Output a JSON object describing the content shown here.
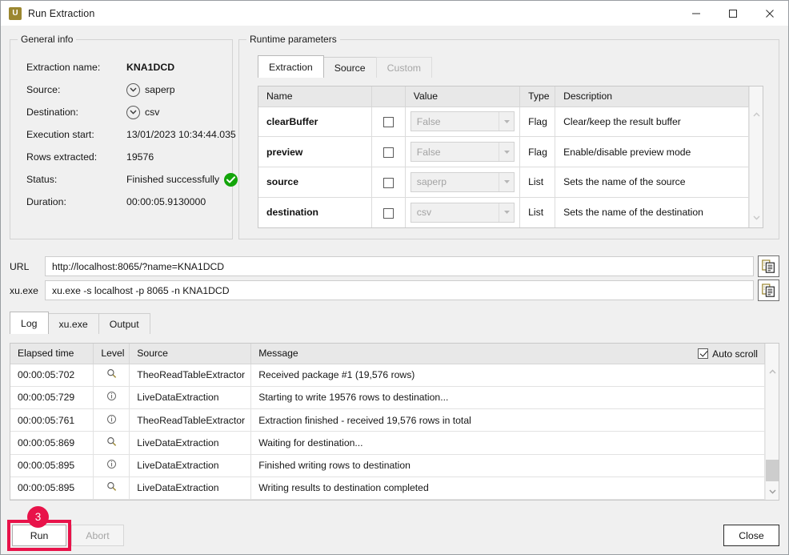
{
  "window": {
    "title": "Run Extraction",
    "app_icon_glyph": "U",
    "app_icon_color": "#9b8730",
    "controls": [
      {
        "name": "minimize",
        "glyph": "minimize-icon"
      },
      {
        "name": "maximize",
        "glyph": "maximize-icon"
      },
      {
        "name": "close",
        "glyph": "close-icon"
      }
    ]
  },
  "general_info": {
    "legend": "General info",
    "rows": [
      {
        "label": "Extraction name:",
        "value": "KNA1DCD",
        "bold": true,
        "icon": null
      },
      {
        "label": "Source:",
        "value": "saperp",
        "bold": false,
        "icon": "circle-chevron-down-icon"
      },
      {
        "label": "Destination:",
        "value": "csv",
        "bold": false,
        "icon": "circle-chevron-down-icon"
      },
      {
        "label": "Execution start:",
        "value": "13/01/2023 10:34:44.035",
        "bold": false,
        "icon": null
      },
      {
        "label": "Rows extracted:",
        "value": "19576",
        "bold": false,
        "icon": null
      },
      {
        "label": "Status:",
        "value": "Finished successfully",
        "bold": false,
        "icon": "success-check-icon"
      },
      {
        "label": "Duration:",
        "value": "00:00:05.9130000",
        "bold": false,
        "icon": null
      }
    ],
    "status_color": "#13a50a"
  },
  "runtime_parameters": {
    "legend": "Runtime parameters",
    "tabs": [
      {
        "label": "Extraction",
        "state": "active"
      },
      {
        "label": "Source",
        "state": "normal"
      },
      {
        "label": "Custom",
        "state": "disabled"
      }
    ],
    "columns": [
      "Name",
      "",
      "Value",
      "Type",
      "Description"
    ],
    "rows": [
      {
        "name": "clearBuffer",
        "checked": false,
        "value": "False",
        "type": "Flag",
        "description": "Clear/keep the result buffer"
      },
      {
        "name": "preview",
        "checked": false,
        "value": "False",
        "type": "Flag",
        "description": "Enable/disable preview mode"
      },
      {
        "name": "source",
        "checked": false,
        "value": "saperp",
        "type": "List",
        "description": "Sets the name of the source"
      },
      {
        "name": "destination",
        "checked": false,
        "value": "csv",
        "type": "List",
        "description": "Sets the name of the destination"
      }
    ]
  },
  "command_rows": [
    {
      "label": "URL",
      "value": "http://localhost:8065/?name=KNA1DCD",
      "copy_icon": "copy-icon"
    },
    {
      "label": "xu.exe",
      "value": "xu.exe -s localhost -p 8065 -n KNA1DCD",
      "copy_icon": "copy-icon"
    }
  ],
  "log": {
    "tabs": [
      {
        "label": "Log",
        "state": "active"
      },
      {
        "label": "xu.exe",
        "state": "normal"
      },
      {
        "label": "Output",
        "state": "normal"
      }
    ],
    "columns": [
      "Elapsed time",
      "Level",
      "Source",
      "Message"
    ],
    "auto_scroll": {
      "label": "Auto scroll",
      "checked": true
    },
    "rows": [
      {
        "elapsed": "00:00:05:702",
        "level": "debug-search-icon",
        "source": "TheoReadTableExtractor",
        "message": "Received package #1 (19,576 rows)"
      },
      {
        "elapsed": "00:00:05:729",
        "level": "info-icon",
        "source": "LiveDataExtraction",
        "message": "Starting to write 19576 rows to destination..."
      },
      {
        "elapsed": "00:00:05:761",
        "level": "info-icon",
        "source": "TheoReadTableExtractor",
        "message": "Extraction finished - received 19,576 rows in total"
      },
      {
        "elapsed": "00:00:05:869",
        "level": "debug-search-icon",
        "source": "LiveDataExtraction",
        "message": "Waiting for destination..."
      },
      {
        "elapsed": "00:00:05:895",
        "level": "info-icon",
        "source": "LiveDataExtraction",
        "message": "Finished writing rows to destination"
      },
      {
        "elapsed": "00:00:05:895",
        "level": "debug-search-icon",
        "source": "LiveDataExtraction",
        "message": "Writing results to destination completed"
      }
    ]
  },
  "footer": {
    "run_label": "Run",
    "abort_label": "Abort",
    "close_label": "Close"
  },
  "annotation": {
    "badge_number": "3",
    "color": "#e8134a"
  }
}
